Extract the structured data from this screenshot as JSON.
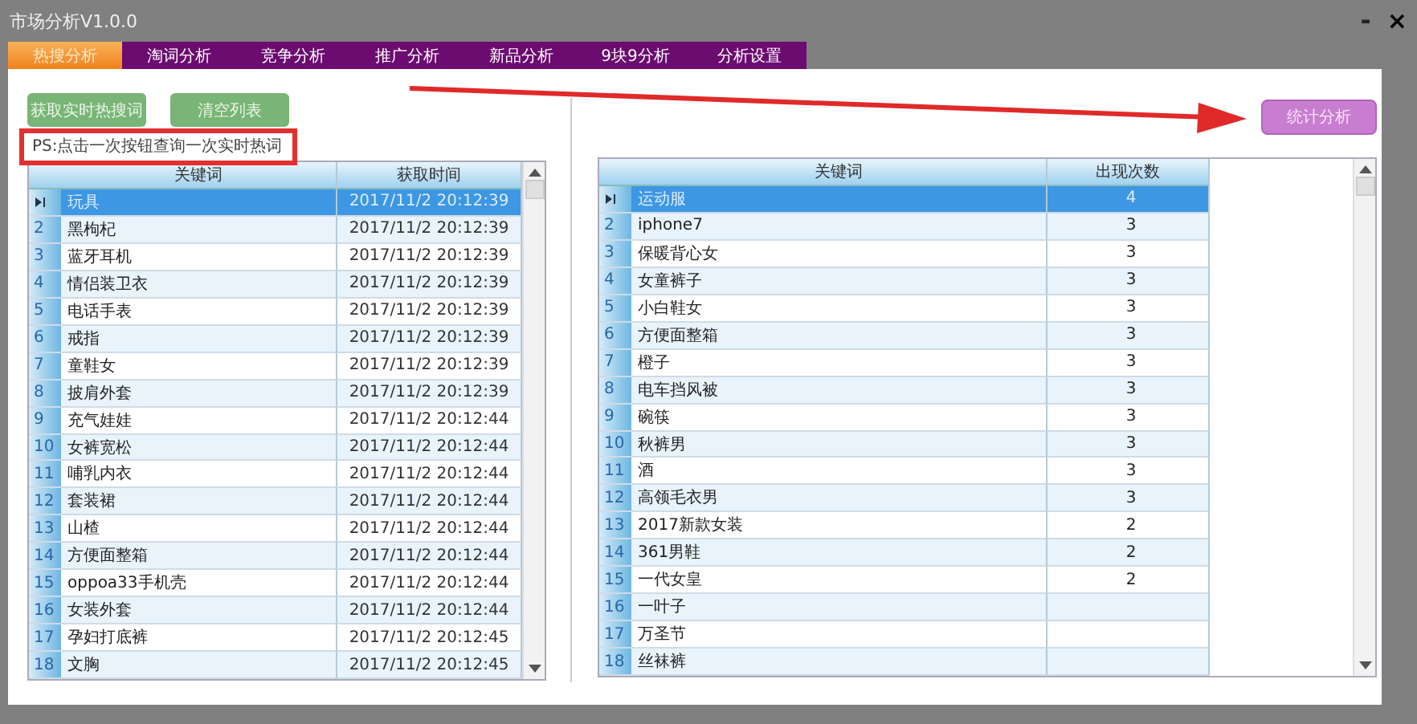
{
  "window": {
    "title": "市场分析V1.0.0",
    "controls": [
      {
        "kind": "minimize",
        "label": "-"
      },
      {
        "kind": "close",
        "label": "×"
      }
    ]
  },
  "tabs": [
    {
      "label": "热搜分析",
      "selected": true
    },
    {
      "label": "淘词分析",
      "selected": false
    },
    {
      "label": "竞争分析",
      "selected": false
    },
    {
      "label": "推广分析",
      "selected": false
    },
    {
      "label": "新品分析",
      "selected": false
    },
    {
      "label": "9块9分析",
      "selected": false
    },
    {
      "label": "分析设置",
      "selected": false
    }
  ],
  "left_panel": {
    "buttons": [
      "获取实时热搜词",
      "清空列表"
    ],
    "note": "PS:点击一次按钮查询一次实时热词",
    "table": {
      "columns": [
        "关键词",
        "获取时间"
      ],
      "rows": [
        {
          "selected": true,
          "keyword": "玩具",
          "time": "2017/11/2 20:12:39"
        },
        {
          "num": "2",
          "selected": false,
          "keyword": "黑枸杞",
          "time": "2017/11/2 20:12:39"
        },
        {
          "num": "3",
          "selected": false,
          "keyword": "蓝牙耳机",
          "time": "2017/11/2 20:12:39"
        },
        {
          "num": "4",
          "selected": false,
          "keyword": "情侣装卫衣",
          "time": "2017/11/2 20:12:39"
        },
        {
          "num": "5",
          "selected": false,
          "keyword": "电话手表",
          "time": "2017/11/2 20:12:39"
        },
        {
          "num": "6",
          "selected": false,
          "keyword": "戒指",
          "time": "2017/11/2 20:12:39"
        },
        {
          "num": "7",
          "selected": false,
          "keyword": "童鞋女",
          "time": "2017/11/2 20:12:39"
        },
        {
          "num": "8",
          "selected": false,
          "keyword": "披肩外套",
          "time": "2017/11/2 20:12:39"
        },
        {
          "num": "9",
          "selected": false,
          "keyword": "充气娃娃",
          "time": "2017/11/2 20:12:44"
        },
        {
          "num": "10",
          "selected": false,
          "keyword": "女裤宽松",
          "time": "2017/11/2 20:12:44"
        },
        {
          "num": "11",
          "selected": false,
          "keyword": "哺乳内衣",
          "time": "2017/11/2 20:12:44"
        },
        {
          "num": "12",
          "selected": false,
          "keyword": "套装裙",
          "time": "2017/11/2 20:12:44"
        },
        {
          "num": "13",
          "selected": false,
          "keyword": "山楂",
          "time": "2017/11/2 20:12:44"
        },
        {
          "num": "14",
          "selected": false,
          "keyword": "方便面整箱",
          "time": "2017/11/2 20:12:44"
        },
        {
          "num": "15",
          "selected": false,
          "keyword": "oppoa33手机壳",
          "time": "2017/11/2 20:12:44"
        },
        {
          "num": "16",
          "selected": false,
          "keyword": "女装外套",
          "time": "2017/11/2 20:12:44"
        },
        {
          "num": "17",
          "selected": false,
          "keyword": "孕妇打底裤",
          "time": "2017/11/2 20:12:45"
        },
        {
          "num": "18",
          "selected": false,
          "keyword": "文胸",
          "time": "2017/11/2 20:12:45"
        }
      ]
    }
  },
  "right_panel": {
    "button": "统计分析",
    "table": {
      "columns": [
        "关键词",
        "出现次数"
      ],
      "rows": [
        {
          "selected": true,
          "keyword": "运动服",
          "count": "4"
        },
        {
          "num": "2",
          "selected": false,
          "keyword": "iphone7",
          "count": "3"
        },
        {
          "num": "3",
          "selected": false,
          "keyword": "保暖背心女",
          "count": "3"
        },
        {
          "num": "4",
          "selected": false,
          "keyword": "女童裤子",
          "count": "3"
        },
        {
          "num": "5",
          "selected": false,
          "keyword": "小白鞋女",
          "count": "3"
        },
        {
          "num": "6",
          "selected": false,
          "keyword": "方便面整箱",
          "count": "3"
        },
        {
          "num": "7",
          "selected": false,
          "keyword": "橙子",
          "count": "3"
        },
        {
          "num": "8",
          "selected": false,
          "keyword": "电车挡风被",
          "count": "3"
        },
        {
          "num": "9",
          "selected": false,
          "keyword": "碗筷",
          "count": "3"
        },
        {
          "num": "10",
          "selected": false,
          "keyword": "秋裤男",
          "count": "3"
        },
        {
          "num": "11",
          "selected": false,
          "keyword": "酒",
          "count": "3"
        },
        {
          "num": "12",
          "selected": false,
          "keyword": "高领毛衣男",
          "count": "3"
        },
        {
          "num": "13",
          "selected": false,
          "keyword": "2017新款女装",
          "count": "2"
        },
        {
          "num": "14",
          "selected": false,
          "keyword": "361男鞋",
          "count": "2"
        },
        {
          "num": "15",
          "selected": false,
          "keyword": "一代女皇",
          "count": "2"
        },
        {
          "num": "16",
          "selected": false,
          "keyword": "一叶子"
        },
        {
          "num": "17",
          "selected": false,
          "keyword": "万圣节"
        },
        {
          "num": "18",
          "selected": false,
          "keyword": "丝袜裤"
        }
      ]
    }
  }
}
